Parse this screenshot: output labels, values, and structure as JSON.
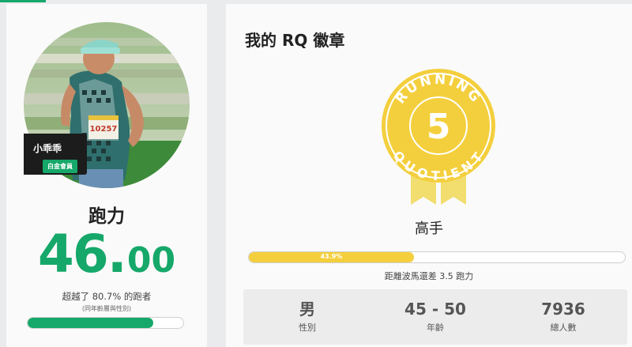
{
  "profile": {
    "name": "小乖乖",
    "tier": "白金會員",
    "bib_number": "10257"
  },
  "metric": {
    "title": "跑力",
    "score_int": "46",
    "score_dot": ".",
    "score_dec": "00",
    "surpass_text": "超越了 80.7% 的跑者",
    "surpass_note": "(同年齡層與性別)",
    "surpass_fraction": 0.807
  },
  "badge": {
    "section_title": "我的 RQ 徽章",
    "ring_text": "RUNNING QUOTIENT",
    "level_number": "5",
    "level_name": "高手",
    "progress_percent": "43.9%",
    "progress_fraction": 0.439,
    "remaining_text": "距離波馬還差 3.5 跑力"
  },
  "stats": [
    {
      "value": "男",
      "label": "性別"
    },
    {
      "value": "45 - 50",
      "label": "年齡"
    },
    {
      "value": "7936",
      "label": "總人數"
    }
  ],
  "colors": {
    "accent_green": "#15a86a",
    "badge_gold": "#f4cf3d"
  }
}
